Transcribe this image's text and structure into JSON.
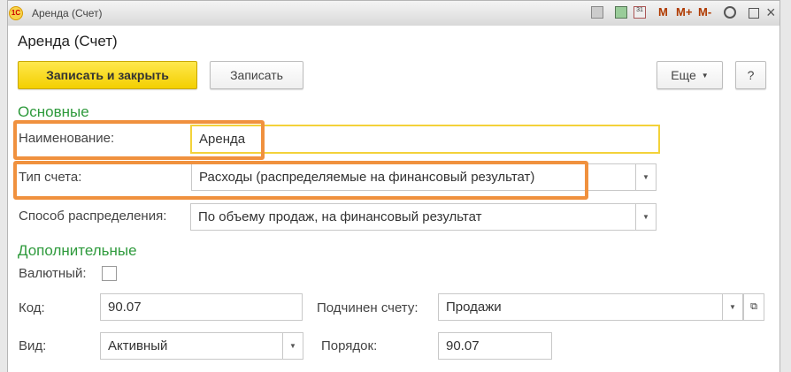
{
  "window": {
    "title": "Аренда (Счет)",
    "toolbar": {
      "m": "M",
      "mplus": "M+",
      "mminus": "M-",
      "close": "×"
    }
  },
  "form": {
    "title": "Аренда (Счет)",
    "buttons": {
      "save_close": "Записать и закрыть",
      "save": "Записать",
      "more": "Еще",
      "help": "?"
    },
    "main_section": "Основные",
    "name_label": "Наименование:",
    "name_value": "Аренда",
    "type_label": "Тип счета:",
    "type_value": "Расходы (распределяемые на финансовый результат)",
    "dist_label": "Способ распределения:",
    "dist_value": "По объему продаж, на финансовый результат",
    "extra_section": "Дополнительные",
    "currency_label": "Валютный:",
    "code_label": "Код:",
    "code_value": "90.07",
    "parent_label": "Подчинен счету:",
    "parent_value": "Продажи",
    "kind_label": "Вид:",
    "kind_value": "Активный",
    "order_label": "Порядок:",
    "order_value": "90.07"
  },
  "colors": {
    "accent": "#f3cf00",
    "section": "#2e9a3c",
    "highlight": "#f0913e"
  }
}
